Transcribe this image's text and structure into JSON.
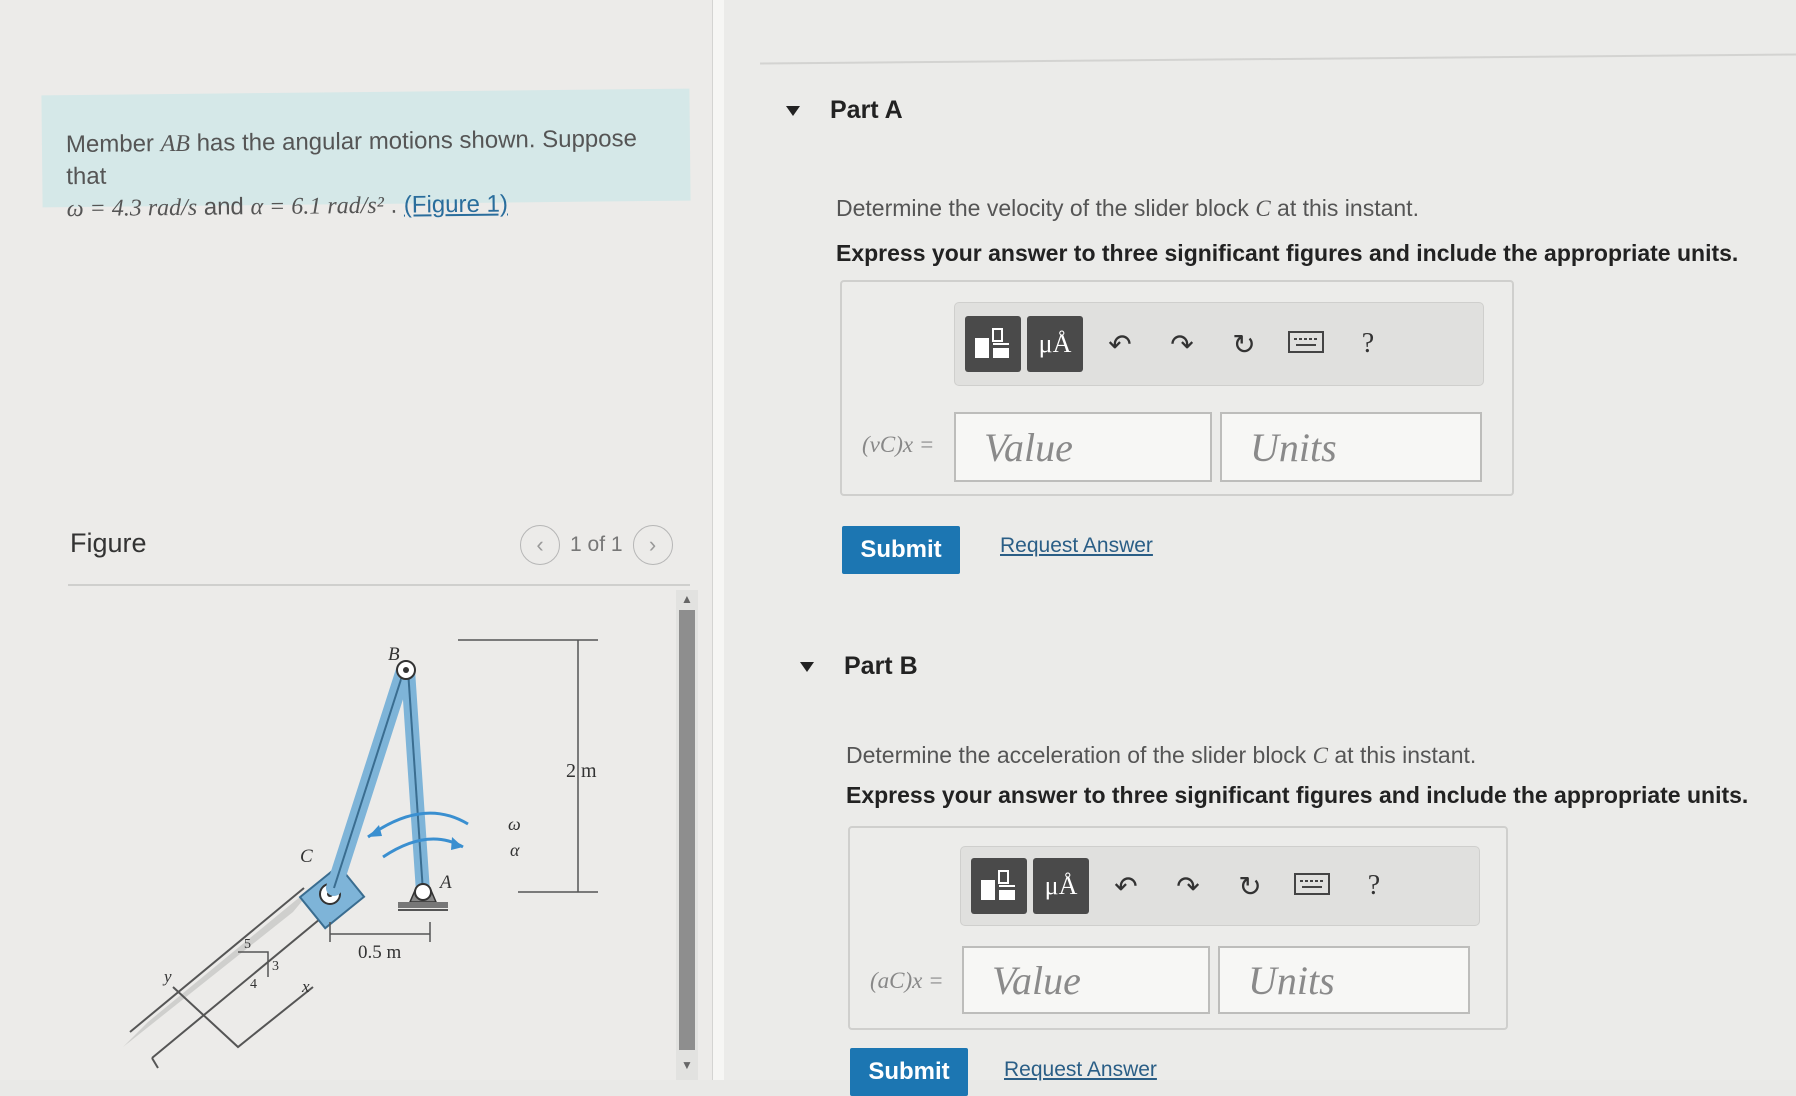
{
  "problem": {
    "line1_pre": "Member ",
    "member": "AB",
    "line1_post": " has the angular motions shown. Suppose that",
    "omega_expr": "ω = 4.3  rad/s",
    "and": " and ",
    "alpha_expr": "α = 6.1  rad/s²",
    "figure_link": "(Figure 1)"
  },
  "figure": {
    "label": "Figure",
    "pager": "1 of 1",
    "prev_icon": "chevron-left",
    "next_icon": "chevron-right",
    "labels": {
      "B": "B",
      "C": "C",
      "A": "A",
      "omega": "ω",
      "alpha": "α",
      "height": "2 m",
      "width": "0.5 m",
      "slope_5": "5",
      "slope_3": "3",
      "slope_4": "4",
      "axis_y": "y",
      "axis_x": "x"
    }
  },
  "parts": [
    {
      "title": "Part A",
      "question_pre": "Determine the velocity of the slider block ",
      "question_var": "C",
      "question_post": " at this instant.",
      "instructions": "Express your answer to three significant figures and include the appropriate units.",
      "variable_label": "(vC)x =",
      "value_placeholder": "Value",
      "units_placeholder": "Units",
      "submit_label": "Submit",
      "request_label": "Request Answer"
    },
    {
      "title": "Part B",
      "question_pre": "Determine the acceleration of the slider block ",
      "question_var": "C",
      "question_post": " at this instant.",
      "instructions": "Express your answer to three significant figures and include the appropriate units.",
      "variable_label": "(aC)x =",
      "value_placeholder": "Value",
      "units_placeholder": "Units",
      "submit_label": "Submit",
      "request_label": "Request Answer"
    }
  ],
  "toolbar": {
    "templates_icon": "templates-icon",
    "units_label": "μÅ",
    "undo_icon": "↶",
    "redo_icon": "↷",
    "reset_icon": "↻",
    "keyboard_icon": "keyboard-icon",
    "help_label": "?"
  }
}
